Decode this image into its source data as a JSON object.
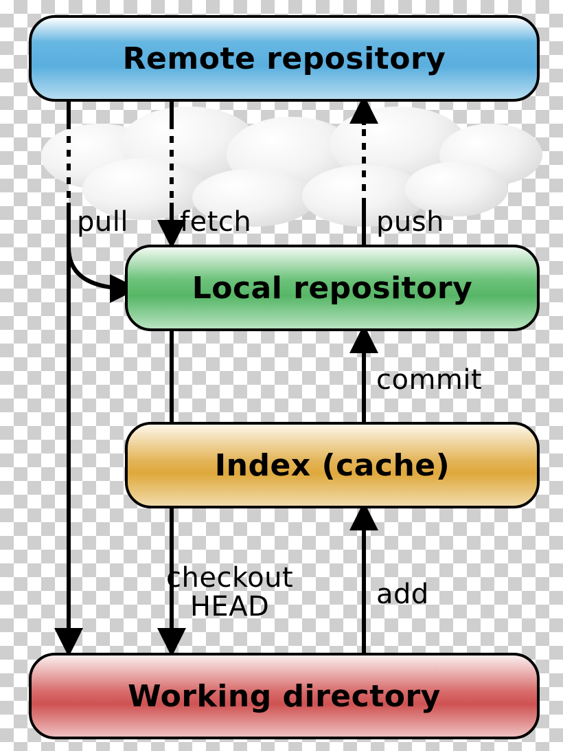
{
  "boxes": {
    "remote": "Remote repository",
    "local": "Local repository",
    "index": "Index (cache)",
    "working": "Working directory"
  },
  "arrows": {
    "pull": "pull",
    "fetch": "fetch",
    "push": "push",
    "commit": "commit",
    "checkout_head": "checkout HEAD",
    "add": "add"
  }
}
